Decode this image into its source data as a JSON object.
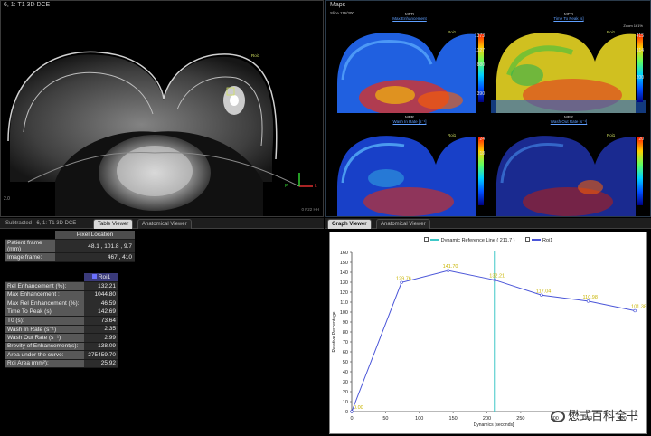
{
  "main_view": {
    "title": "6, 1: T1 3D DCE",
    "roi_label": "Roi1",
    "orient_p": "P",
    "orient_l": "L",
    "footer": "0 P22 HH",
    "corner_small": "2.0"
  },
  "maps": {
    "title": "Maps",
    "slice": "Slice 116/300",
    "cells": [
      {
        "mode": "MPR",
        "name": "Max Enhancement",
        "extra": "",
        "cbar": [
          "1373",
          "1127",
          "880",
          "",
          "390"
        ],
        "roi": "Roi1"
      },
      {
        "mode": "MPR",
        "name": "Time To Peak [s]",
        "extra": "Zoom 161%",
        "cbar": [
          "415",
          "314",
          "",
          "200",
          ""
        ],
        "roi": "Roi1"
      },
      {
        "mode": "MPR",
        "name": "Wash In Rate [s⁻¹]",
        "extra": "",
        "cbar": [
          "24",
          "18",
          "",
          "",
          ""
        ],
        "roi": "Roi1"
      },
      {
        "mode": "MPR",
        "name": "Wash Out Rate [s⁻¹]",
        "extra": "",
        "cbar": [
          "20",
          "",
          "",
          "",
          ""
        ],
        "roi": "Roi1"
      }
    ]
  },
  "table_panel": {
    "tabs": [
      "Subtracted - 6, 1: T1 3D DCE",
      "Table Viewer",
      "Anatomical Viewer"
    ],
    "pixel_header": "Pixel Location",
    "pixel_rows": [
      {
        "key": "Patient frame (mm)",
        "value": "48.1 , 101.8 , 9.7"
      },
      {
        "key": "Image frame:",
        "value": "467 , 410"
      }
    ],
    "roi_header": "Roi1",
    "rows": [
      {
        "key": "Rel Enhancement  (%):",
        "value": "132.21"
      },
      {
        "key": "Max Enhancement :",
        "value": "1044.80"
      },
      {
        "key": "Max Rel Enhancement (%):",
        "value": "46.59"
      },
      {
        "key": "Time To Peak  (s):",
        "value": "142.69"
      },
      {
        "key": "T0 (s):",
        "value": "73.64"
      },
      {
        "key": "Wash In Rate (s⁻¹)",
        "value": "2.35"
      },
      {
        "key": "Wash Out Rate (s⁻¹)",
        "value": "2.99"
      },
      {
        "key": "Brevity of Enhancement(s):",
        "value": "138.09"
      },
      {
        "key": "Area under the curve:",
        "value": "275459.70"
      },
      {
        "key": "Roi Area (mm²):",
        "value": "25.92"
      }
    ]
  },
  "graph_panel": {
    "tabs": [
      "Graph Viewer",
      "Anatomical Viewer"
    ],
    "legend": [
      {
        "label": "Dynamic Reference Line ( 211.7 )",
        "color": "#3ec8c8"
      },
      {
        "label": "Roi1",
        "color": "#4a55d8"
      }
    ],
    "colors": {
      "series": "#4a55d8",
      "reference": "#3ec8c8",
      "labels": "#c8b400"
    }
  },
  "chart_data": {
    "type": "line",
    "xlabel": "Dynamics [seconds]",
    "ylabel": "Relative Percentage",
    "xlim": [
      0,
      420
    ],
    "ylim": [
      0,
      160
    ],
    "xticks": [
      0,
      50,
      100,
      150,
      200,
      250,
      300,
      350,
      400
    ],
    "yticks": [
      0,
      10,
      20,
      30,
      40,
      50,
      60,
      70,
      80,
      90,
      100,
      110,
      120,
      130,
      140,
      150,
      160
    ],
    "grid": false,
    "reference_x": 211.7,
    "series": [
      {
        "name": "Roi1",
        "x": [
          0,
          73.6,
          142.7,
          211.7,
          280.8,
          349.8,
          418.9
        ],
        "y": [
          0.0,
          129.76,
          141.7,
          132.21,
          117.04,
          110.98,
          101.38
        ],
        "labels": [
          "0.00",
          "129.76",
          "141.70",
          "132.21",
          "117.04",
          "110.98",
          "101.38"
        ]
      }
    ]
  },
  "watermark": "懋式百科全书"
}
